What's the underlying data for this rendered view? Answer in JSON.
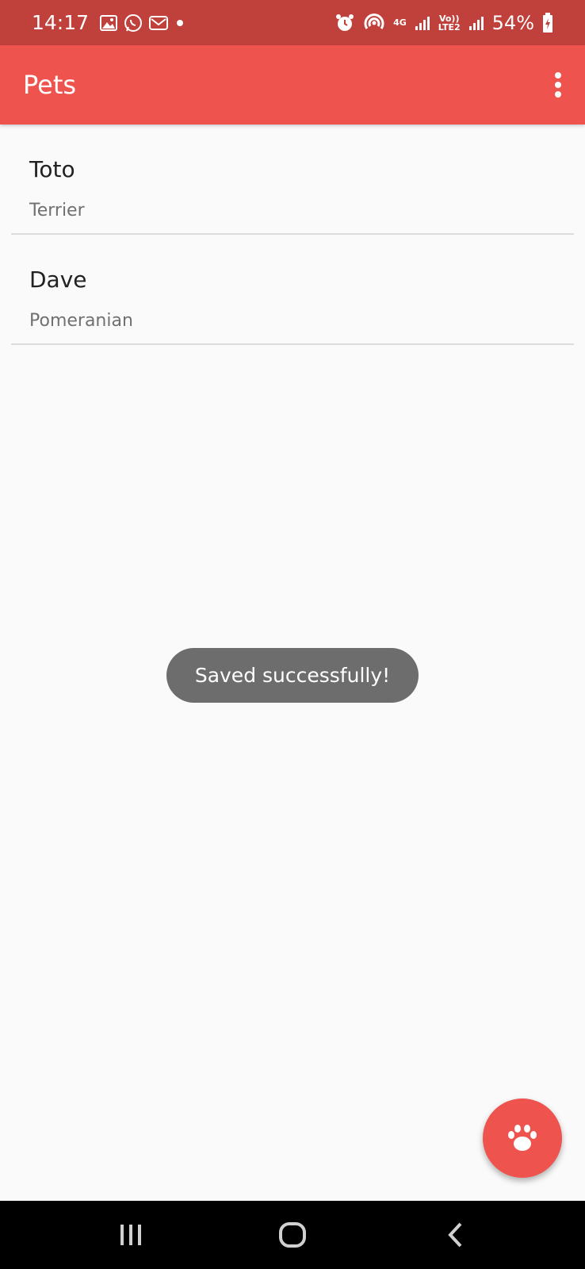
{
  "status_bar": {
    "time": "14:17",
    "network_top": "4G",
    "network_volte": "Vo))",
    "network_lte": "LTE2",
    "battery": "54%"
  },
  "app_bar": {
    "title": "Pets"
  },
  "pets": [
    {
      "name": "Toto",
      "breed": "Terrier"
    },
    {
      "name": "Dave",
      "breed": "Pomeranian"
    }
  ],
  "toast": {
    "message": "Saved successfully!"
  },
  "fab": {
    "icon": "paw-icon"
  },
  "colors": {
    "status_bar": "#c0403b",
    "app_bar": "#ef534e",
    "background": "#fafafa",
    "toast": "#6d6d6d",
    "nav_bar": "#000000"
  }
}
